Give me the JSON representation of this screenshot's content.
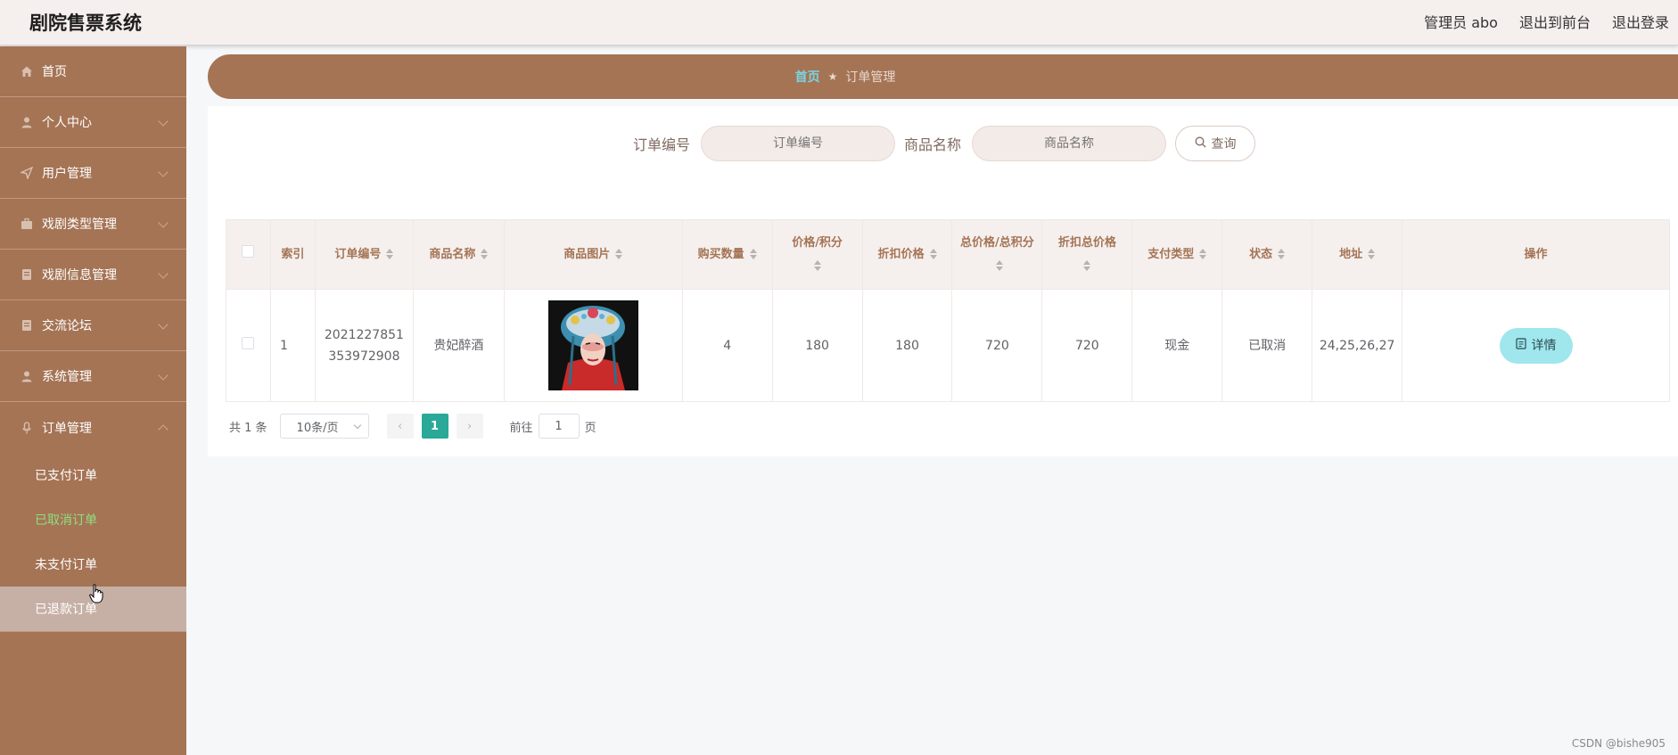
{
  "header": {
    "app_title": "剧院售票系统",
    "user": "管理员 abo",
    "to_front": "退出到前台",
    "logout": "退出登录"
  },
  "sidebar": {
    "items": [
      {
        "label": "首页",
        "icon": "home-icon"
      },
      {
        "label": "个人中心",
        "icon": "user-icon"
      },
      {
        "label": "用户管理",
        "icon": "send-icon"
      },
      {
        "label": "戏剧类型管理",
        "icon": "briefcase-icon"
      },
      {
        "label": "戏剧信息管理",
        "icon": "document-icon"
      },
      {
        "label": "交流论坛",
        "icon": "document-icon"
      },
      {
        "label": "系统管理",
        "icon": "user-icon"
      },
      {
        "label": "订单管理",
        "icon": "microphone-icon"
      }
    ],
    "sub_items": [
      {
        "label": "已支付订单"
      },
      {
        "label": "已取消订单"
      },
      {
        "label": "未支付订单"
      },
      {
        "label": "已退款订单"
      }
    ]
  },
  "breadcrumb": {
    "home": "首页",
    "current": "订单管理"
  },
  "search": {
    "order_no_label": "订单编号",
    "order_no_placeholder": "订单编号",
    "product_label": "商品名称",
    "product_placeholder": "商品名称",
    "query_button": "查询"
  },
  "table": {
    "columns": [
      "索引",
      "订单编号",
      "商品名称",
      "商品图片",
      "购买数量",
      "价格/积分",
      "折扣价格",
      "总价格/总积分",
      "折扣总价格",
      "支付类型",
      "状态",
      "地址",
      "操作"
    ],
    "rows": [
      {
        "index": "1",
        "order_no": "2021227851353972908",
        "order_no_line1": "2021227851",
        "order_no_line2": "353972908",
        "product": "贵妃醉酒",
        "quantity": "4",
        "price": "180",
        "discount_price": "180",
        "total": "720",
        "discount_total": "720",
        "pay_type": "现金",
        "status": "已取消",
        "address": "24,25,26,27",
        "action": "详情"
      }
    ]
  },
  "pagination": {
    "total": "共 1 条",
    "page_size": "10条/页",
    "current_page": "1",
    "goto_prefix": "前往",
    "goto_value": "1",
    "goto_suffix": "页"
  },
  "watermark": "CSDN @bishe905",
  "colors": {
    "sidebar": "#a57455",
    "active_sub": "#8ee07e",
    "breadcrumb_home": "#79d5e3",
    "pager_active": "#2aa898",
    "detail_button": "#9fe6ed"
  }
}
